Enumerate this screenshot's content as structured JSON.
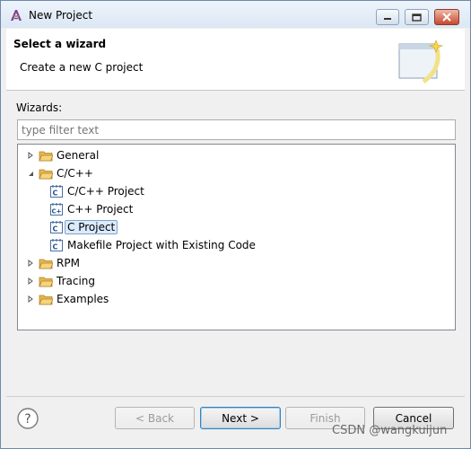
{
  "window": {
    "title": "New Project",
    "controls": {
      "minimize": "minimize",
      "maximize": "maximize",
      "close": "close"
    }
  },
  "header": {
    "title": "Select a wizard",
    "description": "Create a new C project"
  },
  "content": {
    "wizards_label": "Wizards:",
    "filter_placeholder": "type filter text",
    "tree": [
      {
        "label": "General",
        "expanded": false,
        "icon": "folder-icon"
      },
      {
        "label": "C/C++",
        "expanded": true,
        "icon": "folder-icon",
        "children": [
          {
            "label": "C/C++ Project",
            "icon": "c-project-icon"
          },
          {
            "label": "C++ Project",
            "icon": "c-project-icon"
          },
          {
            "label": "C Project",
            "icon": "c-project-icon",
            "selected": true
          },
          {
            "label": "Makefile Project with Existing Code",
            "icon": "c-project-icon"
          }
        ]
      },
      {
        "label": "RPM",
        "expanded": false,
        "icon": "folder-icon"
      },
      {
        "label": "Tracing",
        "expanded": false,
        "icon": "folder-icon"
      },
      {
        "label": "Examples",
        "expanded": false,
        "icon": "folder-icon"
      }
    ]
  },
  "footer": {
    "back": "< Back",
    "next": "Next >",
    "finish": "Finish",
    "cancel": "Cancel"
  },
  "watermark": "CSDN @wangkuijun",
  "colors": {
    "selection": "#dceafc",
    "selection_border": "#7da2ce",
    "folder": "#e8b84a"
  }
}
